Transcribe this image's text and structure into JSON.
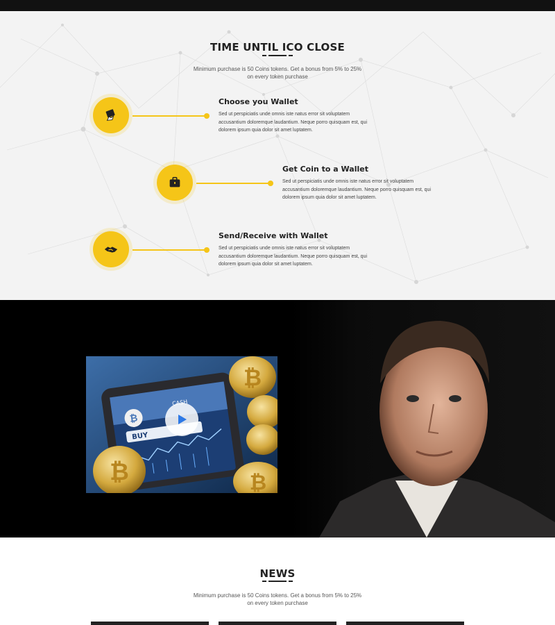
{
  "ico": {
    "title": "TIME UNTIL ICO CLOSE",
    "subtitle_line1": "Minimum purchase is 50 Coins tokens. Get a bonus from 5% to 25%",
    "subtitle_line2": "on every token purchase",
    "steps": [
      {
        "title": "Choose you Wallet",
        "icon": "wallet-hand-icon",
        "line1": "Sed ut perspiciatis unde omnis iste natus error sit voluptatem",
        "line2": "accusantium doloremque laudantium. Neque porro quisquam est, qui",
        "line3": "dolorem ipsum quia dolor sit amet luptatem."
      },
      {
        "title": "Get Coin to a Wallet",
        "icon": "briefcase-icon",
        "line1": "Sed ut perspiciatis unde omnis iste natus error sit voluptatem",
        "line2": "accusantium doloremque laudantium. Neque porro quisquam est, qui",
        "line3": "dolorem ipsum quia dolor sit amet luptatem."
      },
      {
        "title": "Send/Receive with Wallet",
        "icon": "handshake-icon",
        "line1": "Sed ut perspiciatis unde omnis iste natus error sit voluptatem",
        "line2": "accusantium doloremque laudantium. Neque porro quisquam est, qui",
        "line3": "dolorem ipsum quia dolor sit amet luptatem."
      }
    ]
  },
  "video": {
    "thumb_label_buy": "BUY",
    "thumb_label_cash": "CASH",
    "coin_symbol": "₿",
    "play_icon": "play-icon"
  },
  "news": {
    "title": "NEWS",
    "subtitle_line1": "Minimum purchase is 50 Coins tokens. Get a bonus from 5% to 25%",
    "subtitle_line2": "on every token purchase"
  },
  "colors": {
    "accent": "#f5c518",
    "dark": "#222222",
    "video_bg": "#000000"
  }
}
